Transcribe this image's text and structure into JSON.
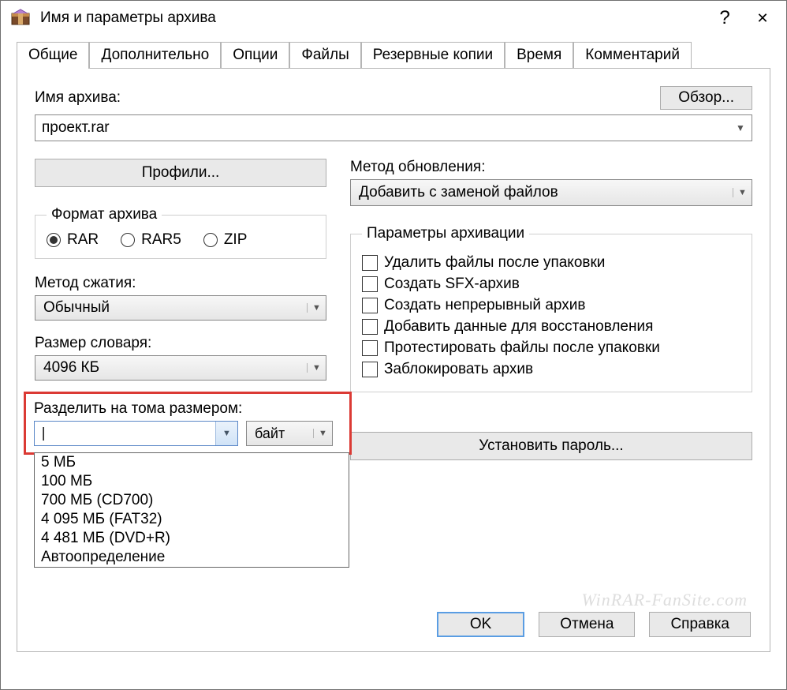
{
  "title": "Имя и параметры архива",
  "help_symbol": "?",
  "close_symbol": "✕",
  "tabs": [
    "Общие",
    "Дополнительно",
    "Опции",
    "Файлы",
    "Резервные копии",
    "Время",
    "Комментарий"
  ],
  "active_tab": 0,
  "archive_name_label": "Имя архива:",
  "browse_label": "Обзор...",
  "archive_name_value": "проект.rar",
  "profiles_label": "Профили...",
  "update_method_label": "Метод обновления:",
  "update_method_value": "Добавить с заменой файлов",
  "format_legend": "Формат архива",
  "formats": [
    "RAR",
    "RAR5",
    "ZIP"
  ],
  "format_selected": 0,
  "compression_label": "Метод сжатия:",
  "compression_value": "Обычный",
  "dict_label": "Размер словаря:",
  "dict_value": "4096 КБ",
  "split_label": "Разделить на тома размером:",
  "split_value": "",
  "split_unit": "байт",
  "split_options": [
    "5 МБ",
    "100 МБ",
    "700 МБ  (CD700)",
    "4 095 МБ  (FAT32)",
    "4 481 МБ  (DVD+R)",
    "Автоопределение"
  ],
  "params_legend": "Параметры архивации",
  "params_checks": [
    "Удалить файлы после упаковки",
    "Создать SFX-архив",
    "Создать непрерывный архив",
    "Добавить данные для восстановления",
    "Протестировать файлы после упаковки",
    "Заблокировать архив"
  ],
  "set_password_label": "Установить пароль...",
  "ok_label": "OK",
  "cancel_label": "Отмена",
  "help_btn_label": "Справка",
  "watermark": "WinRAR-FanSite.com"
}
